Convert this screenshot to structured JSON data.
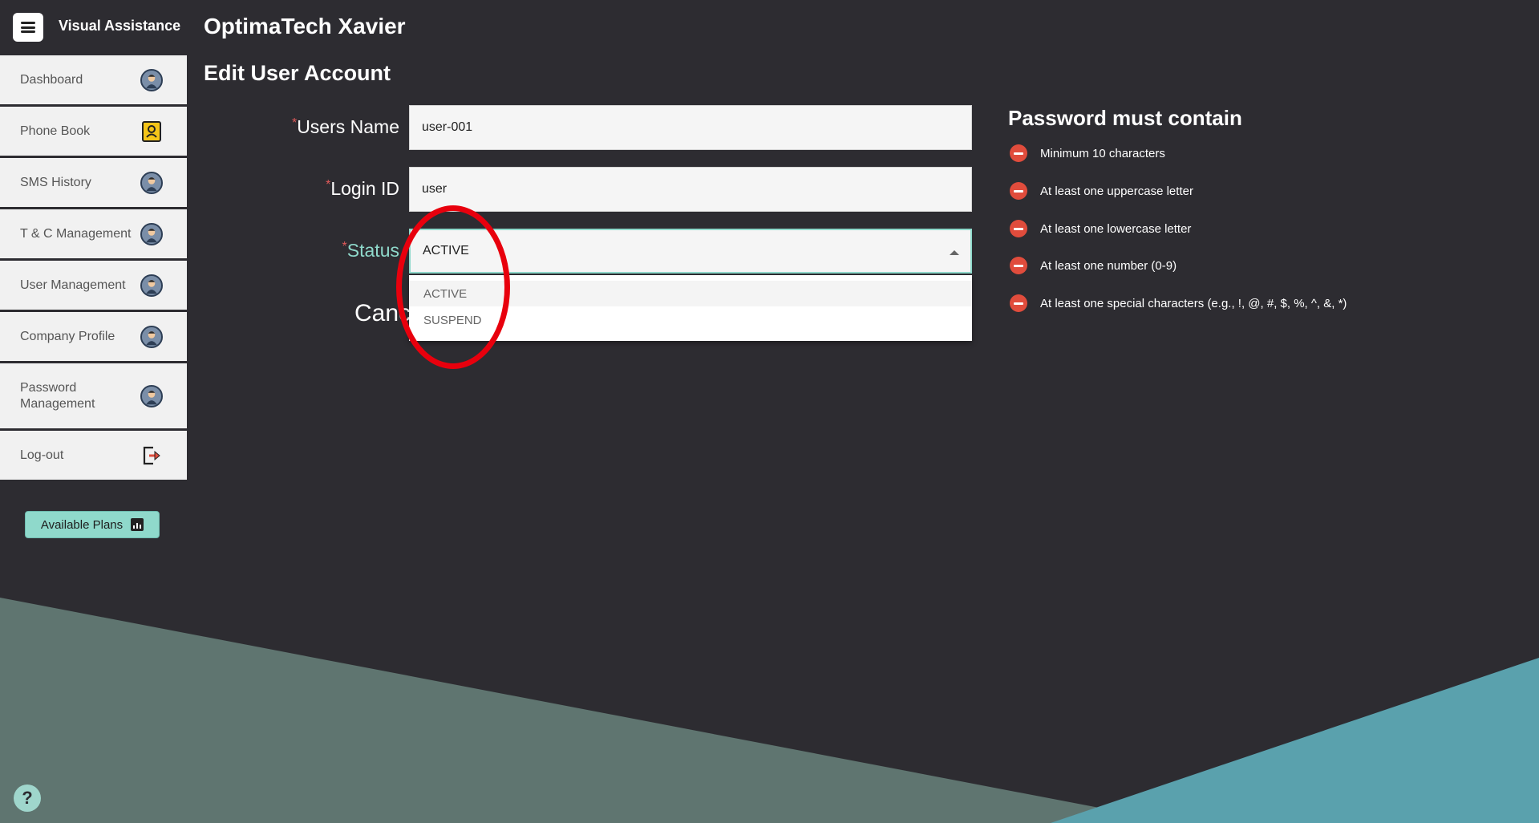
{
  "app": {
    "brand": "Visual Assistance",
    "header": "OptimaTech Xavier",
    "section_title": "Edit User Account"
  },
  "sidebar": {
    "items": [
      {
        "label": "Dashboard",
        "icon": "user-avatar-icon"
      },
      {
        "label": "Phone Book",
        "icon": "contact-book-icon"
      },
      {
        "label": "SMS History",
        "icon": "user-avatar-icon"
      },
      {
        "label": "T & C Management",
        "icon": "user-avatar-icon"
      },
      {
        "label": "User Management",
        "icon": "user-avatar-icon"
      },
      {
        "label": "Company Profile",
        "icon": "user-avatar-icon"
      },
      {
        "label": "Password Management",
        "icon": "user-avatar-icon"
      },
      {
        "label": "Log-out",
        "icon": "logout-icon"
      }
    ],
    "plans_button": "Available Plans"
  },
  "form": {
    "required_mark": "*",
    "users_name_label": "Users Name",
    "users_name_value": "user-001",
    "login_id_label": "Login ID",
    "login_id_value": "user",
    "status_label": "Status",
    "status_value": "ACTIVE",
    "status_options": [
      "ACTIVE",
      "SUSPEND"
    ],
    "cancel_partial": "Canc"
  },
  "password_rules": {
    "title": "Password must contain",
    "items": [
      "Minimum 10 characters",
      "At least one uppercase letter",
      "At least one lowercase letter",
      "At least one number (0-9)",
      "At least one special characters (e.g., !, @, #, $, %, ^, &, *)"
    ]
  },
  "help": "?",
  "colors": {
    "background": "#2d2c31",
    "accent": "#8fd9cb",
    "error": "#e04c3c",
    "highlight": "#e8000d"
  }
}
